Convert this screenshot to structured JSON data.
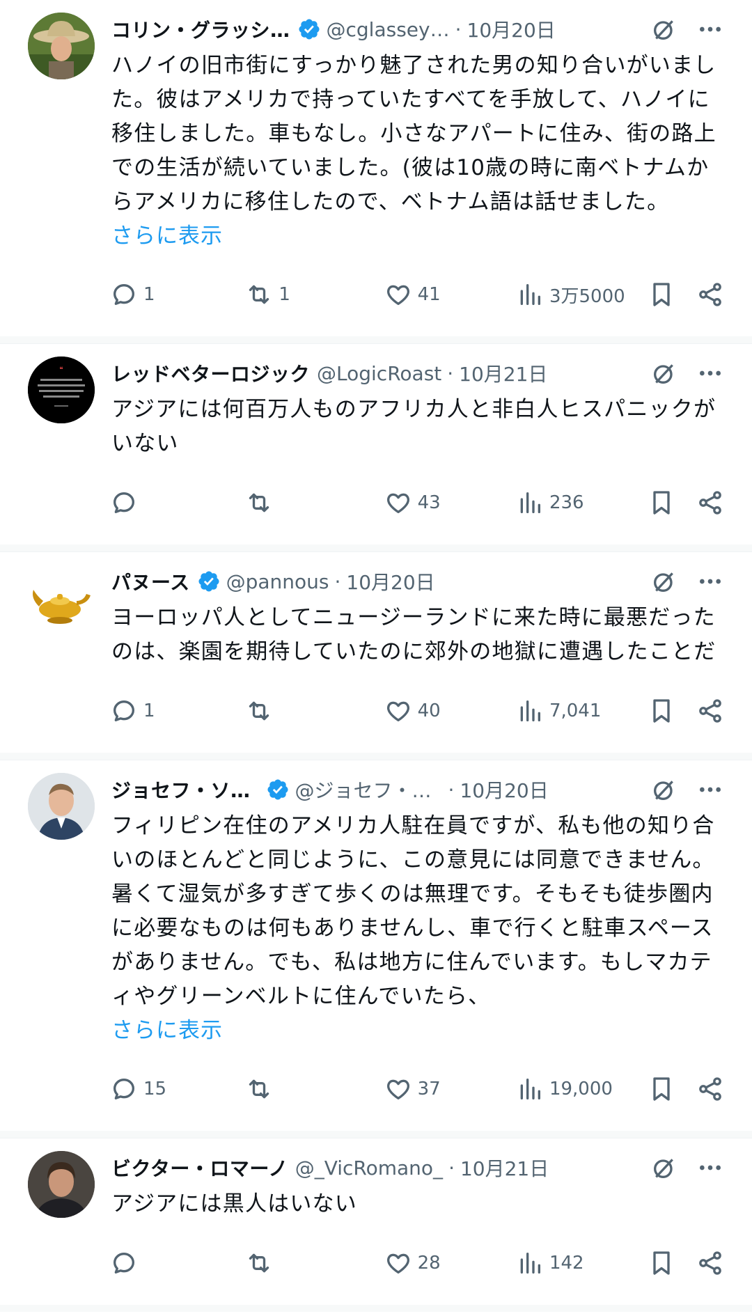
{
  "feed": {
    "more_label": "さらに表示",
    "posts": [
      {
        "name": "コリン・グラッシ…",
        "verified": true,
        "handle": "@cglassey…",
        "date": "10月20日",
        "text": "ハノイの旧市街にすっかり魅了された男の知り合いがいました。彼はアメリカで持っていたすべてを手放して、ハノイに移住しました。車もなし。小さなアパートに住み、街の路上での生活が続いていました。(彼は10歳の時に南ベトナムからアメリカに移住したので、ベトナム語は話せました。",
        "has_more": true,
        "replies": "1",
        "reposts": "1",
        "likes": "41",
        "views": "3万5000"
      },
      {
        "name": "レッドベターロジック",
        "verified": false,
        "handle": "@LogicRoast",
        "date": "10月21日",
        "text": "アジアには何百万人ものアフリカ人と非白人ヒスパニックがいない",
        "has_more": false,
        "replies": "",
        "reposts": "",
        "likes": "43",
        "views": "236"
      },
      {
        "name": "パヌース",
        "verified": true,
        "handle": "@pannous",
        "date": "10月20日",
        "text": "ヨーロッパ人としてニュージーランドに来た時に最悪だったのは、楽園を期待していたのに郊外の地獄に遭遇したことだ",
        "has_more": false,
        "replies": "1",
        "reposts": "",
        "likes": "40",
        "views": "7,041"
      },
      {
        "name": "ジョセフ・ソ…",
        "verified": true,
        "handle": "@ジョセフ・…",
        "date": "10月20日",
        "text": "フィリピン在住のアメリカ人駐在員ですが、私も他の知り合いのほとんどと同じように、この意見には同意できません。暑くて湿気が多すぎて歩くのは無理です。そもそも徒歩圏内に必要なものは何もありませんし、車で行くと駐車スペースがありません。でも、私は地方に住んでいます。もしマカティやグリーンベルトに住んでいたら、",
        "has_more": true,
        "replies": "15",
        "reposts": "",
        "likes": "37",
        "views": "19,000"
      },
      {
        "name": "ビクター・ロマーノ",
        "verified": false,
        "handle": "@_VicRomano_",
        "date": "10月21日",
        "text": "アジアには黒人はいない",
        "has_more": false,
        "replies": "",
        "reposts": "",
        "likes": "28",
        "views": "142"
      }
    ]
  },
  "avatars": [
    "hat-portrait",
    "quote-card",
    "golden-lamp",
    "man-portrait",
    "man-portrait-dark"
  ],
  "colors": {
    "link": "#1d9bf0",
    "muted": "#536471",
    "text": "#0f1419",
    "verified": "#1d9bf0",
    "lamp": "#e0a81c"
  }
}
